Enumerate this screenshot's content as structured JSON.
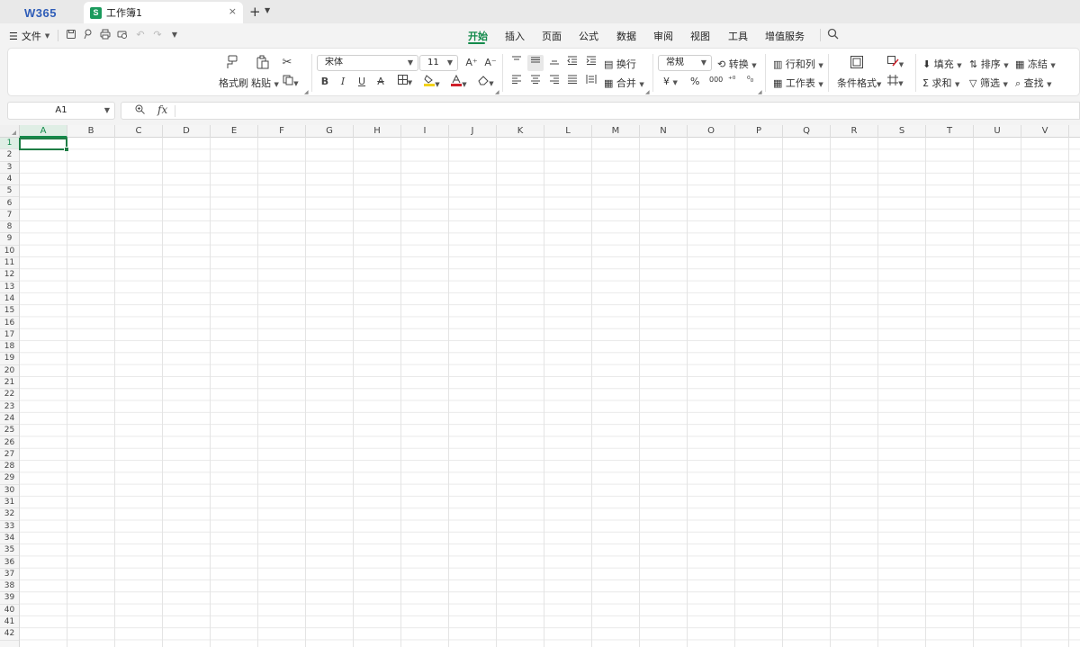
{
  "tabs": {
    "logo": "W365",
    "doc_icon": "S",
    "doc_title": "工作簿1",
    "close": "×",
    "new": "+",
    "new_menu": "⌄"
  },
  "menubar": {
    "file_label": "文件",
    "tabs": [
      "开始",
      "插入",
      "页面",
      "公式",
      "数据",
      "审阅",
      "视图",
      "工具",
      "增值服务"
    ],
    "active_tab": "开始"
  },
  "ribbon": {
    "format_painter": "格式刷",
    "paste": "粘贴",
    "font_name": "宋体",
    "font_size": "11",
    "wrap_text": "换行",
    "merge": "合并",
    "number_format": "常规",
    "convert": "转换",
    "rows_cols": "行和列",
    "worksheet": "工作表",
    "conditional_format": "条件格式",
    "fill": "填充",
    "sort": "排序",
    "freeze": "冻结",
    "sum": "求和",
    "filter": "筛选",
    "find": "查找",
    "bold": "B",
    "italic": "I",
    "underline": "U",
    "strike": "A",
    "font_grow": "A⁺",
    "font_shrink": "A⁻",
    "currency": "¥",
    "percent": "%",
    "thousands": "000",
    "inc_decimal": "⁺⁰",
    "dec_decimal": "⁰₀"
  },
  "formulabar": {
    "cell_ref": "A1",
    "fx": "fx"
  },
  "grid": {
    "columns": [
      "A",
      "B",
      "C",
      "D",
      "E",
      "F",
      "G",
      "H",
      "I",
      "J",
      "K",
      "L",
      "M",
      "N",
      "O",
      "P",
      "Q",
      "R",
      "S",
      "T",
      "U",
      "V"
    ],
    "rows": [
      "1",
      "2",
      "3",
      "4",
      "5",
      "6",
      "7",
      "8",
      "9",
      "10",
      "11",
      "12",
      "13",
      "14",
      "15",
      "16",
      "17",
      "18",
      "19",
      "20",
      "21",
      "22",
      "23",
      "24",
      "25",
      "26",
      "27",
      "28",
      "29",
      "30",
      "31",
      "32",
      "33",
      "34",
      "35",
      "36",
      "37",
      "38",
      "39",
      "40",
      "41",
      "42"
    ],
    "selected_column": "A",
    "selected_row": "1"
  },
  "colors": {
    "accent": "#138a4b",
    "logo": "#2f5db8",
    "sheet_icon": "#1a9a5c",
    "highlight": "#f2d21b",
    "font_color": "#d0202a"
  }
}
